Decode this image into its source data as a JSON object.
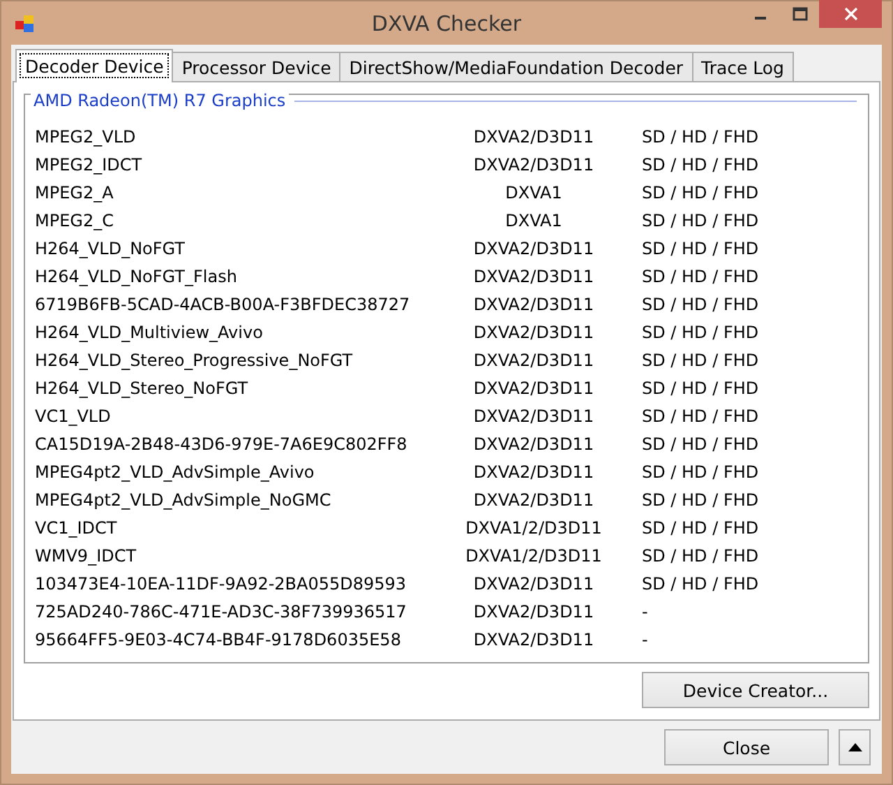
{
  "window": {
    "title": "DXVA Checker"
  },
  "tabs": [
    {
      "label": "Decoder Device",
      "selected": true
    },
    {
      "label": "Processor Device",
      "selected": false
    },
    {
      "label": "DirectShow/MediaFoundation Decoder",
      "selected": false
    },
    {
      "label": "Trace Log",
      "selected": false
    }
  ],
  "group": {
    "title": "AMD Radeon(TM) R7 Graphics"
  },
  "rows": [
    {
      "name": "MPEG2_VLD",
      "api": "DXVA2/D3D11",
      "resolutions": "SD / HD / FHD"
    },
    {
      "name": "MPEG2_IDCT",
      "api": "DXVA2/D3D11",
      "resolutions": "SD / HD / FHD"
    },
    {
      "name": "MPEG2_A",
      "api": "DXVA1",
      "resolutions": "SD / HD / FHD"
    },
    {
      "name": "MPEG2_C",
      "api": "DXVA1",
      "resolutions": "SD / HD / FHD"
    },
    {
      "name": "H264_VLD_NoFGT",
      "api": "DXVA2/D3D11",
      "resolutions": "SD / HD / FHD"
    },
    {
      "name": "H264_VLD_NoFGT_Flash",
      "api": "DXVA2/D3D11",
      "resolutions": "SD / HD / FHD"
    },
    {
      "name": "6719B6FB-5CAD-4ACB-B00A-F3BFDEC38727",
      "api": "DXVA2/D3D11",
      "resolutions": "SD / HD / FHD"
    },
    {
      "name": "H264_VLD_Multiview_Avivo",
      "api": "DXVA2/D3D11",
      "resolutions": "SD / HD / FHD"
    },
    {
      "name": "H264_VLD_Stereo_Progressive_NoFGT",
      "api": "DXVA2/D3D11",
      "resolutions": "SD / HD / FHD"
    },
    {
      "name": "H264_VLD_Stereo_NoFGT",
      "api": "DXVA2/D3D11",
      "resolutions": "SD / HD / FHD"
    },
    {
      "name": "VC1_VLD",
      "api": "DXVA2/D3D11",
      "resolutions": "SD / HD / FHD"
    },
    {
      "name": "CA15D19A-2B48-43D6-979E-7A6E9C802FF8",
      "api": "DXVA2/D3D11",
      "resolutions": "SD / HD / FHD"
    },
    {
      "name": "MPEG4pt2_VLD_AdvSimple_Avivo",
      "api": "DXVA2/D3D11",
      "resolutions": "SD / HD / FHD"
    },
    {
      "name": "MPEG4pt2_VLD_AdvSimple_NoGMC",
      "api": "DXVA2/D3D11",
      "resolutions": "SD / HD / FHD"
    },
    {
      "name": "VC1_IDCT",
      "api": "DXVA1/2/D3D11",
      "resolutions": "SD / HD / FHD"
    },
    {
      "name": "WMV9_IDCT",
      "api": "DXVA1/2/D3D11",
      "resolutions": "SD / HD / FHD"
    },
    {
      "name": "103473E4-10EA-11DF-9A92-2BA055D89593",
      "api": "DXVA2/D3D11",
      "resolutions": "SD / HD / FHD"
    },
    {
      "name": "725AD240-786C-471E-AD3C-38F739936517",
      "api": "DXVA2/D3D11",
      "resolutions": "-"
    },
    {
      "name": "95664FF5-9E03-4C74-BB4F-9178D6035E58",
      "api": "DXVA2/D3D11",
      "resolutions": "-"
    }
  ],
  "device_creator_button": "Device Creator...",
  "close_button": "Close"
}
